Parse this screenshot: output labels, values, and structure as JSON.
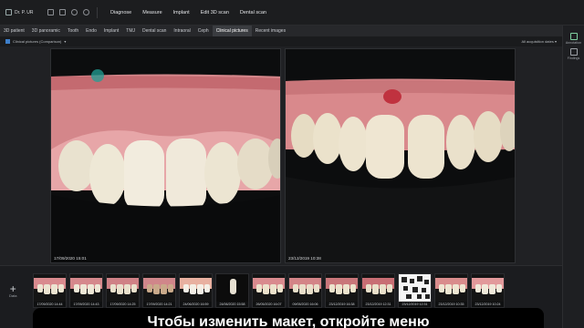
{
  "header": {
    "patient_name": "Dr. P. UR",
    "menu": [
      "Diagnose",
      "Measure",
      "Implant",
      "Edit 3D scan",
      "Dental scan"
    ]
  },
  "tabs": [
    "3D patient",
    "3D panoramic",
    "Tooth",
    "Endo",
    "Implant",
    "TMJ",
    "Dental scan",
    "Intraoral",
    "Ceph",
    "Clinical pictures",
    "Recent images"
  ],
  "active_tab": "Clinical pictures",
  "toolbar": {
    "layout_label": "Clinical pictures (Comparison)",
    "filter_label": "All acquisition dates"
  },
  "viewer": {
    "left_date": "17/09/2020 15:01",
    "right_date": "23/12/2019 10:38"
  },
  "sidebar": {
    "items": [
      "Annotation",
      "Findings"
    ]
  },
  "bottom": {
    "add_label": "Data",
    "thumbs": [
      "17/09/2020 14:44",
      "17/09/2020 14:43",
      "17/09/2020 14:25",
      "17/09/2020 14:21",
      "24/06/2020 16:59",
      "24/06/2020 15:58",
      "26/05/2020 16:07",
      "09/05/2020 16:06",
      "23/12/2019 16:38",
      "23/12/2019 12:31",
      "23/12/2019 12:31",
      "23/12/2019 10:35",
      "23/12/2019 10:24"
    ]
  },
  "subtitle": "Чтобы изменить макет, откройте меню",
  "colors": {
    "accent": "#3e7fc9",
    "cursor": "#22a096"
  }
}
